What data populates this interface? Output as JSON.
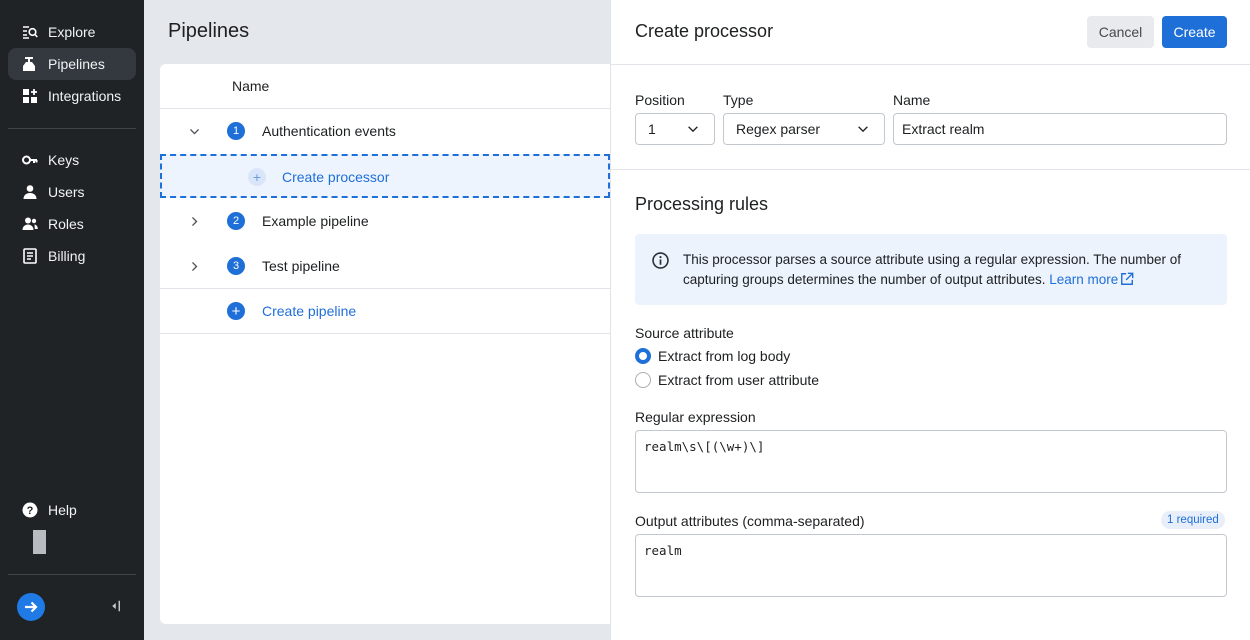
{
  "sidebar": {
    "items": [
      {
        "label": "Explore",
        "icon": "explore-icon"
      },
      {
        "label": "Pipelines",
        "icon": "pipelines-icon",
        "active": true
      },
      {
        "label": "Integrations",
        "icon": "integrations-icon"
      },
      {
        "label": "Keys",
        "icon": "key-icon"
      },
      {
        "label": "Users",
        "icon": "user-icon"
      },
      {
        "label": "Roles",
        "icon": "roles-icon"
      },
      {
        "label": "Billing",
        "icon": "billing-icon"
      }
    ],
    "help_label": "Help"
  },
  "main": {
    "title": "Pipelines",
    "column_name": "Name",
    "pipelines": [
      {
        "number": "1",
        "name": "Authentication events",
        "expanded": true
      },
      {
        "number": "2",
        "name": "Example pipeline",
        "expanded": false
      },
      {
        "number": "3",
        "name": "Test pipeline",
        "expanded": false
      }
    ],
    "create_processor_label": "Create processor",
    "create_pipeline_label": "Create pipeline"
  },
  "drawer": {
    "title": "Create processor",
    "cancel_label": "Cancel",
    "create_label": "Create",
    "position_label": "Position",
    "position_value": "1",
    "type_label": "Type",
    "type_value": "Regex parser",
    "name_label": "Name",
    "name_value": "Extract realm",
    "section_title": "Processing rules",
    "info_text": "This processor parses a source attribute using a regular expression. The number of capturing groups determines the number of output attributes.",
    "info_link": "Learn more",
    "source_label": "Source attribute",
    "source_options": [
      {
        "label": "Extract from log body",
        "checked": true
      },
      {
        "label": "Extract from user attribute",
        "checked": false
      }
    ],
    "regex_label": "Regular expression",
    "regex_value": "realm\\s\\[(\\w+)\\]",
    "output_label": "Output attributes (comma-separated)",
    "output_badge": "1 required",
    "output_value": "realm"
  },
  "colors": {
    "accent": "#1f6fd8",
    "sidebar_bg": "#1f2326",
    "info_bg": "#ecf3fd"
  }
}
